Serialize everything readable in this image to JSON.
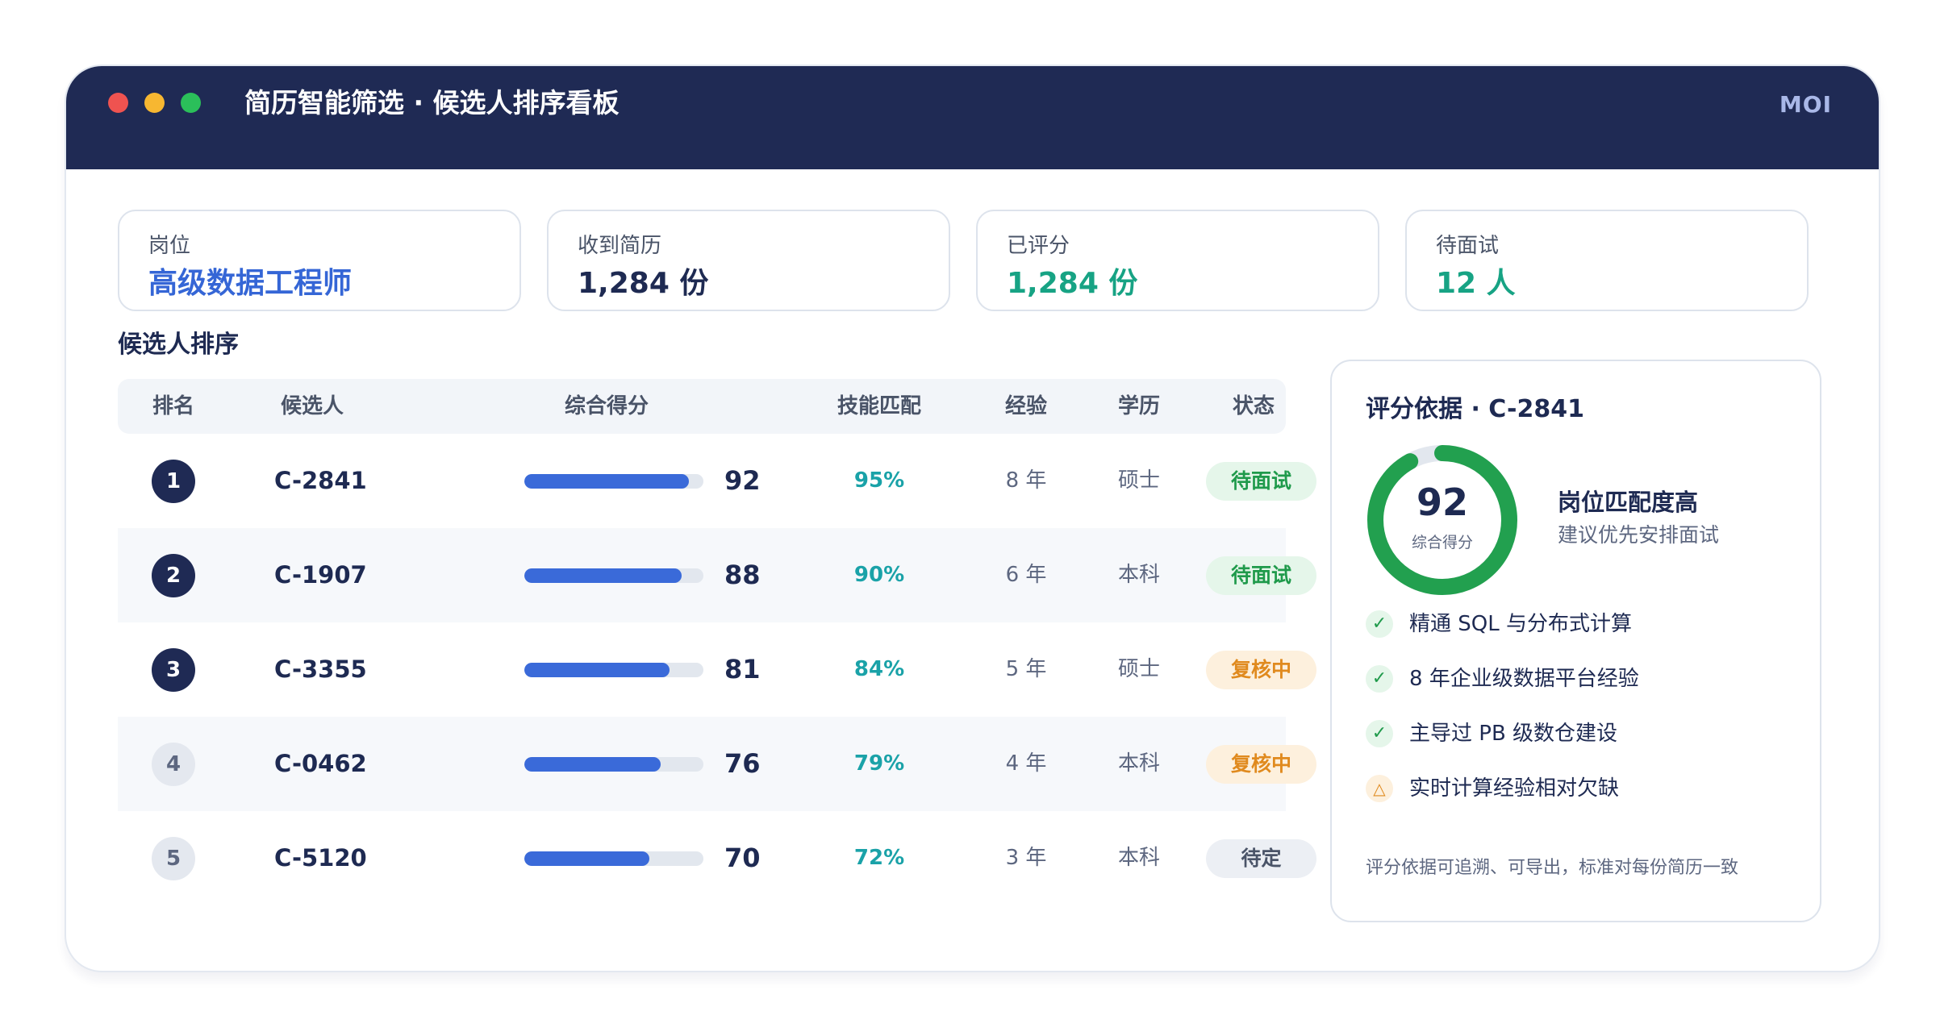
{
  "app": {
    "title": "简历智能筛选 · 候选人排序看板",
    "brand": "MOI"
  },
  "stats": [
    {
      "label": "岗位",
      "value": "高级数据工程师",
      "color": "#3566d6"
    },
    {
      "label": "收到简历",
      "value": "1,284 份",
      "color": "#1e2a52"
    },
    {
      "label": "已评分",
      "value": "1,284 份",
      "color": "#17a384"
    },
    {
      "label": "待面试",
      "value": "12 人",
      "color": "#17a384"
    }
  ],
  "ranking": {
    "title": "候选人排序",
    "columns": [
      "排名",
      "候选人",
      "综合得分",
      "技能匹配",
      "经验",
      "学历",
      "状态"
    ],
    "rows": [
      {
        "rank": "1",
        "id": "C-2841",
        "score": "92",
        "skill": "95%",
        "exp": "8 年",
        "edu": "硕士",
        "status": "待面试",
        "status_type": "green"
      },
      {
        "rank": "2",
        "id": "C-1907",
        "score": "88",
        "skill": "90%",
        "exp": "6 年",
        "edu": "本科",
        "status": "待面试",
        "status_type": "green"
      },
      {
        "rank": "3",
        "id": "C-3355",
        "score": "81",
        "skill": "84%",
        "exp": "5 年",
        "edu": "硕士",
        "status": "复核中",
        "status_type": "orange"
      },
      {
        "rank": "4",
        "id": "C-0462",
        "score": "76",
        "skill": "79%",
        "exp": "4 年",
        "edu": "本科",
        "status": "复核中",
        "status_type": "orange"
      },
      {
        "rank": "5",
        "id": "C-5120",
        "score": "70",
        "skill": "72%",
        "exp": "3 年",
        "edu": "本科",
        "status": "待定",
        "status_type": "gray"
      }
    ]
  },
  "detail": {
    "title": "评分依据 · C-2841",
    "score": "92",
    "score_label": "综合得分",
    "match_title": "岗位匹配度高",
    "match_sub": "建议优先安排面试",
    "reasons": [
      {
        "text": "精通 SQL 与分布式计算",
        "type": "ok",
        "icon": "check-icon"
      },
      {
        "text": "8 年企业级数据平台经验",
        "type": "ok",
        "icon": "check-icon"
      },
      {
        "text": "主导过 PB 级数仓建设",
        "type": "ok",
        "icon": "check-icon"
      },
      {
        "text": "实时计算经验相对欠缺",
        "type": "warn",
        "icon": "warning-icon"
      }
    ],
    "footer": "评分依据可追溯、可导出，标准对每份简历一致"
  },
  "colors": {
    "header": "#1f2a54",
    "bar": "#3a6ad9",
    "gauge": "#22a04f",
    "skill": "#1aa2a8"
  }
}
